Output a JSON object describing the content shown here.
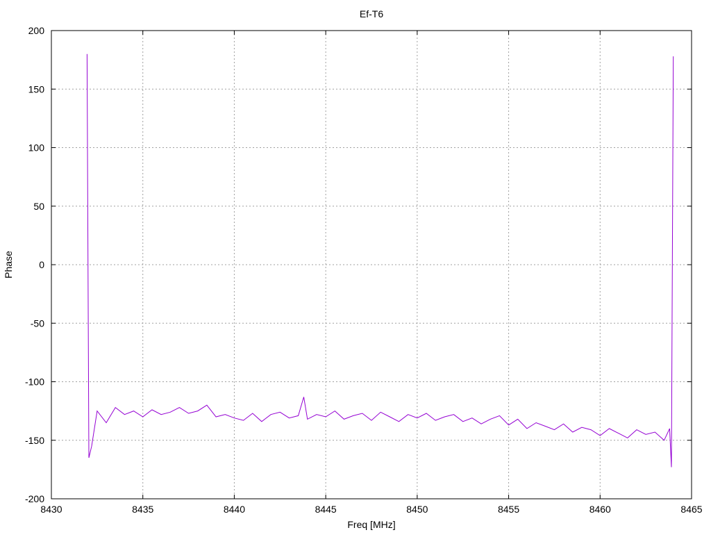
{
  "chart_data": {
    "type": "line",
    "title": "Ef-T6",
    "xlabel": "Freq [MHz]",
    "ylabel": "Phase",
    "xlim": [
      8430,
      8465
    ],
    "ylim": [
      -200,
      200
    ],
    "xticks": [
      8430,
      8435,
      8440,
      8445,
      8450,
      8455,
      8460,
      8465
    ],
    "yticks": [
      -200,
      -150,
      -100,
      -50,
      0,
      50,
      100,
      150,
      200
    ],
    "grid": true,
    "legend": "none",
    "series": [
      {
        "name": "phase",
        "color": "#9400d3",
        "x": [
          8431.95,
          8432.0,
          8432.05,
          8432.2,
          8432.5,
          8433,
          8433.5,
          8434,
          8434.5,
          8435,
          8435.5,
          8436,
          8436.5,
          8437,
          8437.5,
          8438,
          8438.5,
          8439,
          8439.5,
          8440,
          8440.5,
          8441,
          8441.5,
          8442,
          8442.5,
          8443,
          8443.5,
          8443.8,
          8444,
          8444.5,
          8445,
          8445.5,
          8446,
          8446.5,
          8447,
          8447.5,
          8448,
          8448.5,
          8449,
          8449.5,
          8450,
          8450.5,
          8451,
          8451.5,
          8452,
          8452.5,
          8453,
          8453.5,
          8454,
          8454.5,
          8455,
          8455.5,
          8456,
          8456.5,
          8457,
          8457.5,
          8458,
          8458.5,
          8459,
          8459.5,
          8460,
          8460.5,
          8461,
          8461.5,
          8462,
          8462.5,
          8463,
          8463.5,
          8463.8,
          8463.9,
          8463.95,
          8464.0
        ],
        "y": [
          180,
          5,
          -165,
          -155,
          -125,
          -135,
          -122,
          -128,
          -125,
          -130,
          -124,
          -128,
          -126,
          -122,
          -127,
          -125,
          -120,
          -130,
          -128,
          -131,
          -133,
          -127,
          -134,
          -128,
          -126,
          -131,
          -129,
          -113,
          -132,
          -128,
          -130,
          -125,
          -132,
          -129,
          -127,
          -133,
          -126,
          -130,
          -134,
          -128,
          -131,
          -127,
          -133,
          -130,
          -128,
          -134,
          -131,
          -136,
          -132,
          -129,
          -137,
          -132,
          -140,
          -135,
          -138,
          -141,
          -136,
          -143,
          -139,
          -141,
          -146,
          -140,
          -144,
          -148,
          -141,
          -145,
          -143,
          -150,
          -140,
          -173,
          -3,
          178
        ]
      }
    ]
  }
}
